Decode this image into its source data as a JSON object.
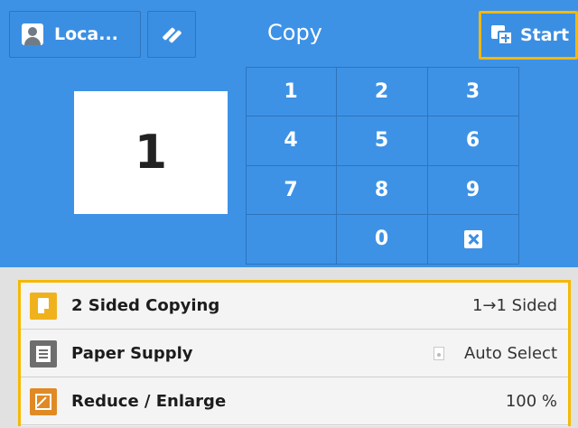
{
  "header": {
    "login_label": "Loca...",
    "title": "Copy",
    "start_label": "Start"
  },
  "quantity": "1",
  "keypad": {
    "keys": [
      "1",
      "2",
      "3",
      "4",
      "5",
      "6",
      "7",
      "8",
      "9",
      "0"
    ]
  },
  "features": [
    {
      "name": "2 Sided Copying",
      "value": "1→1 Sided",
      "icon": "two-sided-icon"
    },
    {
      "name": "Paper Supply",
      "value": "Auto Select",
      "icon": "paper-tray-icon"
    },
    {
      "name": "Reduce / Enlarge",
      "value": "100 %",
      "icon": "reduce-enlarge-icon"
    }
  ],
  "colors": {
    "panel_blue": "#3d92e6",
    "highlight": "#f5b800",
    "two_sided_icon": "#f0b21c",
    "paper_icon": "#6e6e6e",
    "reduce_icon": "#e08a25"
  }
}
